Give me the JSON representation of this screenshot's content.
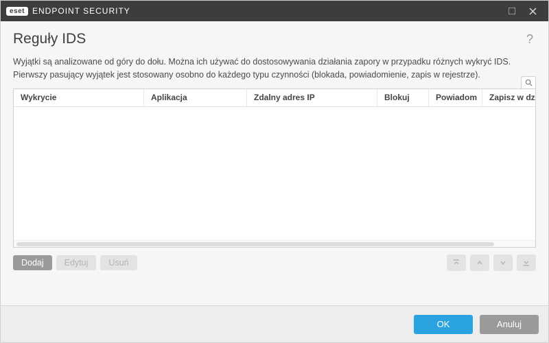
{
  "titlebar": {
    "badge": "eset",
    "product": "ENDPOINT SECURITY"
  },
  "page": {
    "title": "Reguły IDS",
    "help_symbol": "?",
    "description": "Wyjątki są analizowane od góry do dołu. Można ich używać do dostosowywania działania zapory w przypadku różnych wykryć IDS. Pierwszy pasujący wyjątek jest stosowany osobno do każdego typu czynności (blokada, powiadomienie, zapis w rejestrze)."
  },
  "table": {
    "columns": [
      "Wykrycie",
      "Aplikacja",
      "Zdalny adres IP",
      "Blokuj",
      "Powiadom",
      "Zapisz w dzie"
    ],
    "rows": []
  },
  "actions": {
    "add": "Dodaj",
    "edit": "Edytuj",
    "delete": "Usuń"
  },
  "footer": {
    "ok": "OK",
    "cancel": "Anuluj"
  }
}
